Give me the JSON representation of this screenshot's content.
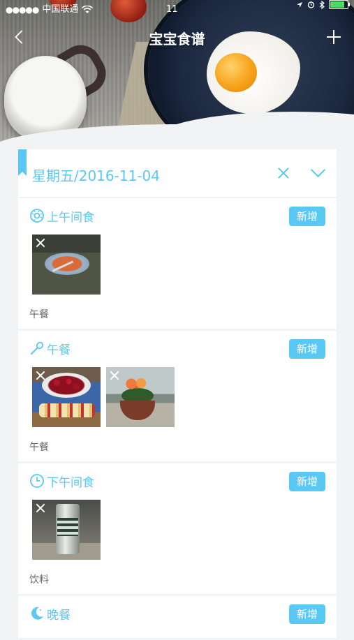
{
  "status_bar": {
    "carrier": "中国联通",
    "time": "11",
    "battery_color": "#4cd964"
  },
  "nav": {
    "title": "宝宝食谱",
    "back_icon": "chevron-left-icon",
    "add_icon": "plus-icon"
  },
  "day": {
    "label": "星期五/2016-11-04"
  },
  "accent_color": "#5ac8f5",
  "meals": [
    {
      "title": "上午间食",
      "icon": "donut-icon",
      "add_label": "新增",
      "photos": [
        "pizza-plate-photo"
      ],
      "note": "午餐"
    },
    {
      "title": "午餐",
      "icon": "spoon-icon",
      "add_label": "新增",
      "photos": [
        "cherries-fruit-photo",
        "potted-flower-photo"
      ],
      "note": "午餐"
    },
    {
      "title": "下午间食",
      "icon": "clock-icon",
      "add_label": "新增",
      "photos": [
        "drink-can-photo"
      ],
      "note": "饮料"
    },
    {
      "title": "晚餐",
      "icon": "moon-icon",
      "add_label": "新增",
      "photos": [],
      "note": ""
    }
  ]
}
